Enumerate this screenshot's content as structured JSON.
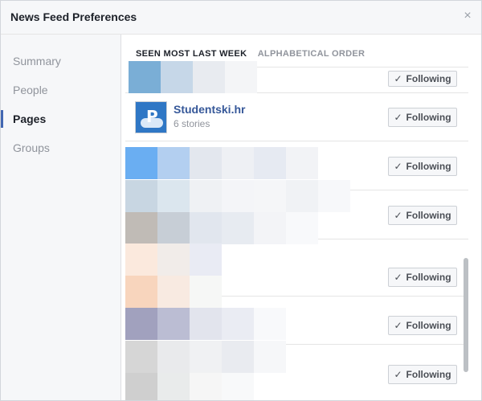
{
  "dialog": {
    "title": "News Feed Preferences",
    "close_glyph": "×"
  },
  "sidebar": {
    "items": [
      {
        "label": "Summary"
      },
      {
        "label": "People"
      },
      {
        "label": "Pages"
      },
      {
        "label": "Groups"
      }
    ],
    "active": "Pages"
  },
  "tabs": [
    {
      "label": "SEEN MOST LAST WEEK",
      "active": true
    },
    {
      "label": "ALPHABETICAL ORDER",
      "active": false
    }
  ],
  "rows": [
    {
      "type": "blurred",
      "button_label": "Following"
    },
    {
      "type": "page",
      "name": "Studentski.hr",
      "meta": "6 stories",
      "button_label": "Following",
      "icon": "studentski-logo"
    },
    {
      "type": "blurred",
      "button_label": "Following"
    },
    {
      "type": "blurred",
      "button_label": "Following"
    },
    {
      "type": "blurred",
      "button_label": "Following"
    },
    {
      "type": "blurred",
      "button_label": "Following"
    },
    {
      "type": "blurred",
      "button_label": "Following"
    }
  ],
  "colors": {
    "accent": "#4267b2",
    "link": "#365899",
    "muted": "#90949c"
  }
}
